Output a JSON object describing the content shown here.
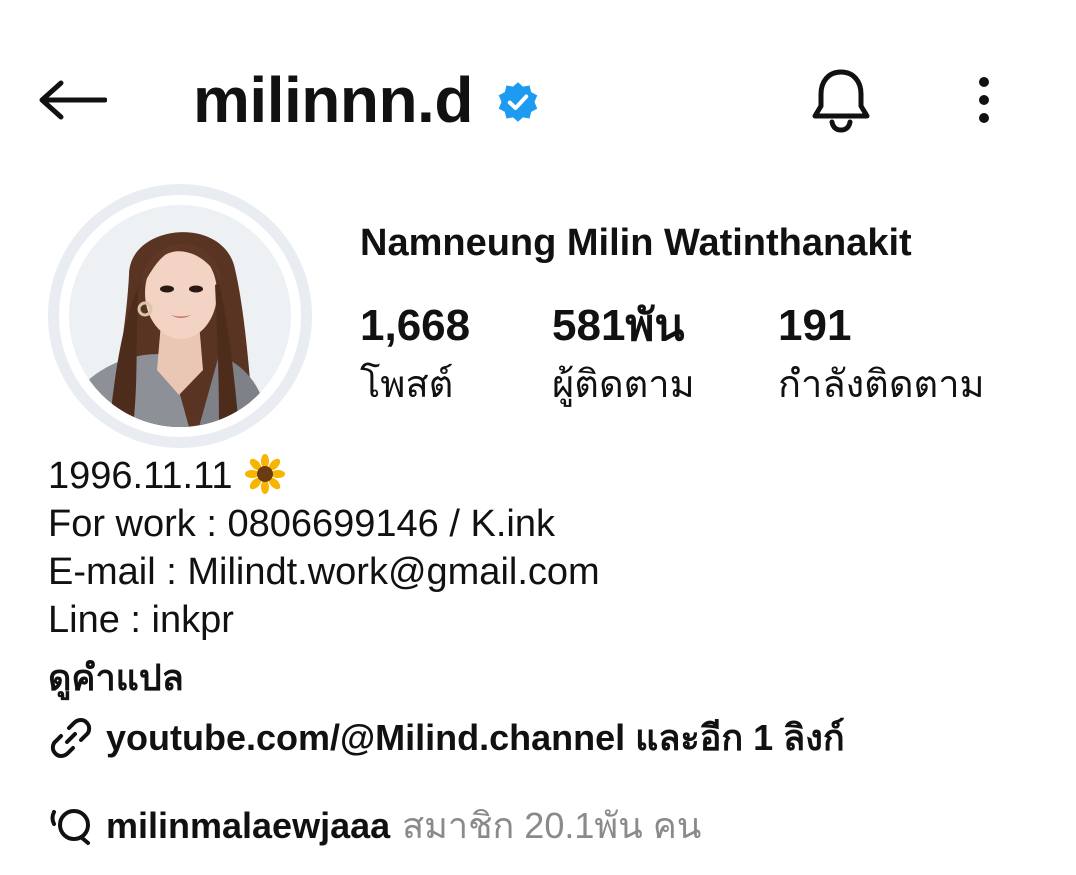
{
  "header": {
    "username": "milinnn.d",
    "verified_color": "#1d9bf0"
  },
  "profile": {
    "full_name": "Namneung Milin Watinthanakit",
    "stats": [
      {
        "value": "1,668",
        "label": "โพสต์"
      },
      {
        "value": "581พัน",
        "label": "ผู้ติดตาม"
      },
      {
        "value": "191",
        "label": "กำลังติดตาม"
      }
    ]
  },
  "bio": {
    "line1": "1996.11.11",
    "line1_emoji": "sunflower-icon",
    "line2": "For work : 0806699146 / K.ink",
    "line3": "E-mail : Milindt.work@gmail.com",
    "line4": "Line : inkpr"
  },
  "translate_label": "ดูคำแปล",
  "link": {
    "text": "youtube.com/@Milind.channel และอีก 1 ลิงก์"
  },
  "channel": {
    "name": "milinmalaewjaaa",
    "members": "สมาชิก 20.1พัน คน"
  }
}
